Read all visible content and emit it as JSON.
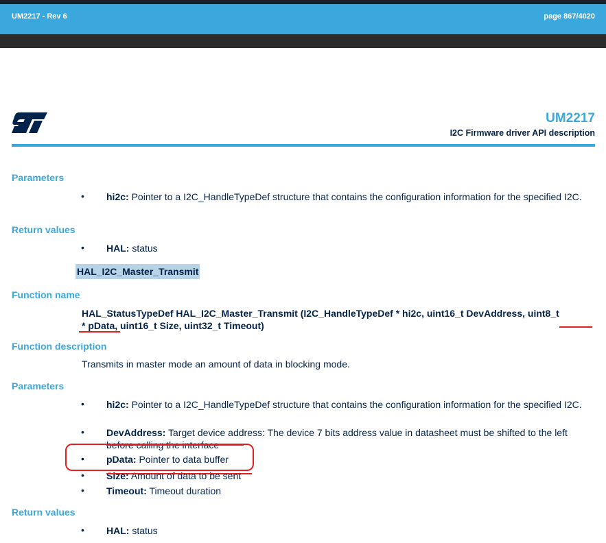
{
  "header": {
    "doc_rev": "UM2217 - Rev 6",
    "page": "page 867/4020"
  },
  "brand": {
    "doc_id": "UM2217",
    "subtitle": "I2C Firmware driver API description"
  },
  "sections": {
    "params_1_label": "Parameters",
    "params_1": [
      {
        "name": "hi2c:",
        "desc": "Pointer to a I2C_HandleTypeDef structure that contains the configuration information for the specified I2C."
      }
    ],
    "return_1_label": "Return values",
    "return_1": [
      {
        "name": "HAL:",
        "desc": "status"
      }
    ],
    "function_heading": "HAL_I2C_Master_Transmit",
    "function_name_label": "Function name",
    "prototype_part1": "HAL_StatusTypeDef HAL_I2C_Master_Transmit (I2C_HandleTypeDef * hi2c, uint16_t DevAddress, uint8_t",
    "prototype_part2": "* pData, uint16_t Size, uint32_t Timeout)",
    "function_desc_label": "Function description",
    "function_desc": "Transmits in master mode an amount of data in blocking mode.",
    "params_2_label": "Parameters",
    "params_2": [
      {
        "name": "hi2c:",
        "desc": "Pointer to a I2C_HandleTypeDef structure that contains the configuration information for the specified I2C."
      },
      {
        "name": "DevAddress:",
        "desc": "Target device address: The device 7 bits address value in datasheet must be shifted to the left before calling the interface"
      },
      {
        "name": "pData:",
        "desc": "Pointer to data buffer"
      },
      {
        "name": "Size:",
        "desc": "Amount of data to be sent"
      },
      {
        "name": "Timeout:",
        "desc": "Timeout duration"
      }
    ],
    "return_2_label": "Return values",
    "return_2": [
      {
        "name": "HAL:",
        "desc": "status"
      }
    ]
  },
  "bullet_char": "•",
  "colors": {
    "accent": "#3aa8dc",
    "text": "#03234b",
    "annotation": "#e02020"
  }
}
